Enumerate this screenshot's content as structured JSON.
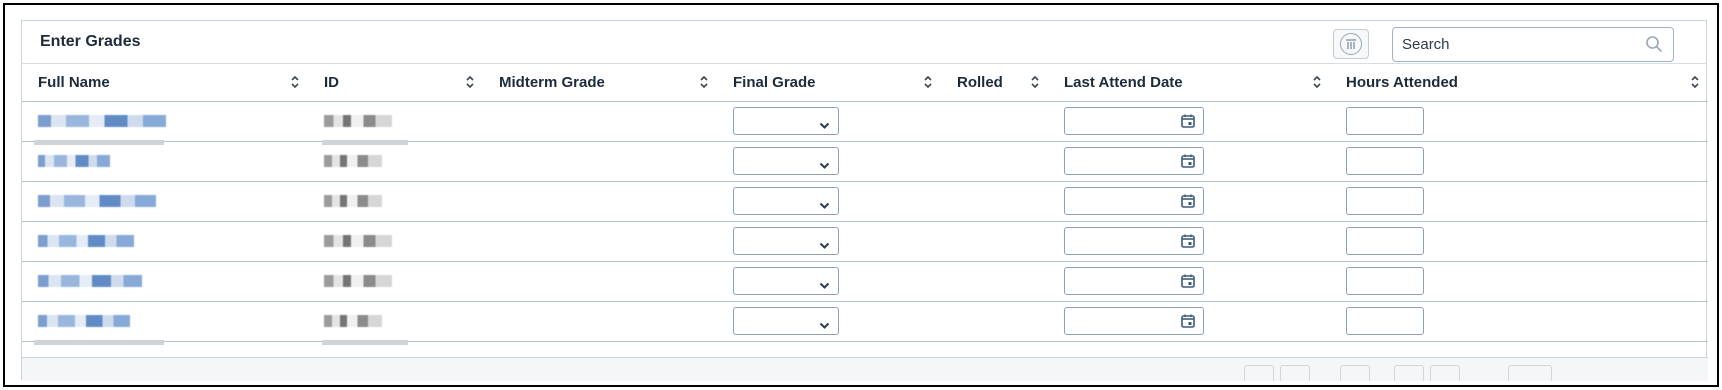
{
  "panel": {
    "title": "Enter Grades",
    "search_placeholder": "Search",
    "column_toggle_icon": "column-select-icon",
    "search_icon": "magnifier-icon"
  },
  "columns": [
    {
      "label": "Full Name"
    },
    {
      "label": "ID"
    },
    {
      "label": "Midterm Grade"
    },
    {
      "label": "Final Grade"
    },
    {
      "label": "Rolled"
    },
    {
      "label": "Last Attend Date"
    },
    {
      "label": "Hours Attended"
    }
  ],
  "rows": [
    {
      "final_grade": "",
      "last_attend_date": "",
      "hours_attended": ""
    },
    {
      "final_grade": "",
      "last_attend_date": "",
      "hours_attended": ""
    },
    {
      "final_grade": "",
      "last_attend_date": "",
      "hours_attended": ""
    },
    {
      "final_grade": "",
      "last_attend_date": "",
      "hours_attended": ""
    },
    {
      "final_grade": "",
      "last_attend_date": "",
      "hours_attended": ""
    },
    {
      "final_grade": "",
      "last_attend_date": "",
      "hours_attended": ""
    }
  ],
  "colors": {
    "header_text": "#1d2b3a",
    "border": "#b7c3ce",
    "calendar_icon": "#3c5a7a",
    "redacted_name": "#6e94c9"
  }
}
